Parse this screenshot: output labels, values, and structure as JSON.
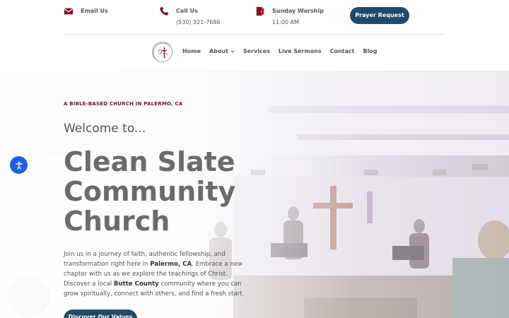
{
  "header": {
    "email": {
      "label": "Email Us",
      "icon": "envelope-icon"
    },
    "call": {
      "label": "Call Us",
      "value": "(530) 321-7686",
      "icon": "phone-icon"
    },
    "worship": {
      "label": "Sunday Worship",
      "value": "11:00 AM",
      "icon": "church-door-icon"
    },
    "prayer_button": "Prayer Request"
  },
  "nav": {
    "items": [
      {
        "label": "Home"
      },
      {
        "label": "About",
        "has_dropdown": true
      },
      {
        "label": "Services"
      },
      {
        "label": "Live Sermons"
      },
      {
        "label": "Contact"
      },
      {
        "label": "Blog"
      }
    ]
  },
  "hero": {
    "tagline": "A BIBLE-BASED CHURCH IN PALERMO, CA",
    "welcome": "Welcome to...",
    "title_line1": "Clean Slate",
    "title_line2": "Community",
    "title_line3": "Church",
    "intro": {
      "p1": "Join us in a journey of faith, authentic fellowship, and transformation right here in ",
      "b1": "Palermo, CA",
      "p2": ". Embrace a new chapter with us as we explore the teachings of Christ. Discover a local ",
      "b2": "Butte County",
      "p3": " community where you can grow spiritually, connect with others, and find a fresh start."
    },
    "cta_label": "Discover Our Values"
  },
  "colors": {
    "accent": "#7a0f28",
    "button": "#214a6a",
    "accessibility": "#1f5fe8"
  },
  "accessibility_icon": "accessibility-icon"
}
